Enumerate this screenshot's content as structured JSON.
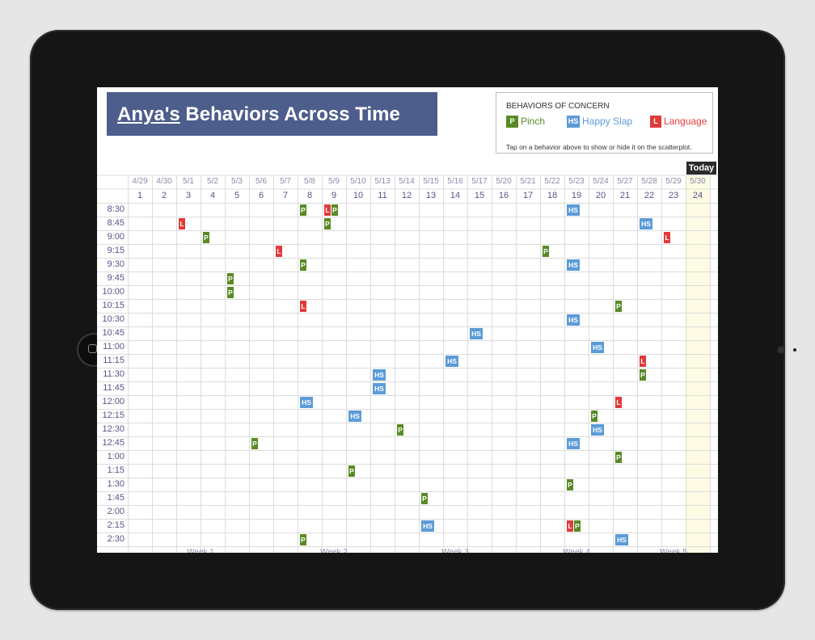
{
  "header": {
    "title_name": "Anya's",
    "title_rest": " Behaviors Across Time"
  },
  "legend": {
    "title": "BEHAVIORS OF CONCERN",
    "note": "Tap on a behavior above to show or hide it on the scatterplot.",
    "items": [
      {
        "code": "P",
        "label": "Pinch",
        "color": "#5a8a25",
        "label_color": "#5a8a25"
      },
      {
        "code": "HS",
        "label": "Happy Slap",
        "color": "#5b9bd8",
        "label_color": "#5b9bd8"
      },
      {
        "code": "L",
        "label": "Language",
        "color": "#e03b3b",
        "label_color": "#e03b3b"
      }
    ]
  },
  "today_label": "Today",
  "today_index": 23,
  "columns": [
    {
      "date": "4/29",
      "day": "1"
    },
    {
      "date": "4/30",
      "day": "2"
    },
    {
      "date": "5/1",
      "day": "3"
    },
    {
      "date": "5/2",
      "day": "4"
    },
    {
      "date": "5/3",
      "day": "5"
    },
    {
      "date": "5/6",
      "day": "6"
    },
    {
      "date": "5/7",
      "day": "7"
    },
    {
      "date": "5/8",
      "day": "8"
    },
    {
      "date": "5/9",
      "day": "9"
    },
    {
      "date": "5/10",
      "day": "10"
    },
    {
      "date": "5/13",
      "day": "11"
    },
    {
      "date": "5/14",
      "day": "12"
    },
    {
      "date": "5/15",
      "day": "13"
    },
    {
      "date": "5/16",
      "day": "14"
    },
    {
      "date": "5/17",
      "day": "15"
    },
    {
      "date": "5/20",
      "day": "16"
    },
    {
      "date": "5/21",
      "day": "17"
    },
    {
      "date": "5/22",
      "day": "18"
    },
    {
      "date": "5/23",
      "day": "19"
    },
    {
      "date": "5/24",
      "day": "20"
    },
    {
      "date": "5/27",
      "day": "21"
    },
    {
      "date": "5/28",
      "day": "22"
    },
    {
      "date": "5/29",
      "day": "23"
    },
    {
      "date": "5/30",
      "day": "24"
    }
  ],
  "times": [
    "8:30",
    "8:45",
    "9:00",
    "9:15",
    "9:30",
    "9:45",
    "10:00",
    "10:15",
    "10:30",
    "10:45",
    "11:00",
    "11:15",
    "11:30",
    "11:45",
    "12:00",
    "12:15",
    "12:30",
    "12:45",
    "1:00",
    "1:15",
    "1:30",
    "1:45",
    "2:00",
    "2:15",
    "2:30"
  ],
  "weeks": [
    {
      "label": "Week 1",
      "start": 0,
      "span": 6
    },
    {
      "label": "Week 2",
      "start": 6,
      "span": 5
    },
    {
      "label": "Week 3",
      "start": 11,
      "span": 5
    },
    {
      "label": "Week 4",
      "start": 16,
      "span": 5
    },
    {
      "label": "Week 5",
      "start": 21,
      "span": 3
    }
  ],
  "events": [
    {
      "day": 8,
      "time": "8:30",
      "codes": [
        "P"
      ]
    },
    {
      "day": 9,
      "time": "8:30",
      "codes": [
        "L",
        "P"
      ]
    },
    {
      "day": 19,
      "time": "8:30",
      "codes": [
        "HS"
      ]
    },
    {
      "day": 3,
      "time": "8:45",
      "codes": [
        "L"
      ]
    },
    {
      "day": 9,
      "time": "8:45",
      "codes": [
        "P"
      ]
    },
    {
      "day": 22,
      "time": "8:45",
      "codes": [
        "HS"
      ]
    },
    {
      "day": 4,
      "time": "9:00",
      "codes": [
        "P"
      ]
    },
    {
      "day": 23,
      "time": "9:00",
      "codes": [
        "L"
      ]
    },
    {
      "day": 7,
      "time": "9:15",
      "codes": [
        "L"
      ]
    },
    {
      "day": 18,
      "time": "9:15",
      "codes": [
        "P"
      ]
    },
    {
      "day": 8,
      "time": "9:30",
      "codes": [
        "P"
      ]
    },
    {
      "day": 19,
      "time": "9:30",
      "codes": [
        "HS"
      ]
    },
    {
      "day": 5,
      "time": "9:45",
      "codes": [
        "P"
      ]
    },
    {
      "day": 5,
      "time": "10:00",
      "codes": [
        "P"
      ]
    },
    {
      "day": 8,
      "time": "10:15",
      "codes": [
        "L"
      ]
    },
    {
      "day": 21,
      "time": "10:15",
      "codes": [
        "P"
      ]
    },
    {
      "day": 19,
      "time": "10:30",
      "codes": [
        "HS"
      ]
    },
    {
      "day": 15,
      "time": "10:45",
      "codes": [
        "HS"
      ]
    },
    {
      "day": 20,
      "time": "11:00",
      "codes": [
        "HS"
      ]
    },
    {
      "day": 14,
      "time": "11:15",
      "codes": [
        "HS"
      ]
    },
    {
      "day": 22,
      "time": "11:15",
      "codes": [
        "L"
      ]
    },
    {
      "day": 11,
      "time": "11:30",
      "codes": [
        "HS"
      ]
    },
    {
      "day": 22,
      "time": "11:30",
      "codes": [
        "P"
      ]
    },
    {
      "day": 11,
      "time": "11:45",
      "codes": [
        "HS"
      ]
    },
    {
      "day": 8,
      "time": "12:00",
      "codes": [
        "HS"
      ]
    },
    {
      "day": 21,
      "time": "12:00",
      "codes": [
        "L"
      ]
    },
    {
      "day": 10,
      "time": "12:15",
      "codes": [
        "HS"
      ]
    },
    {
      "day": 20,
      "time": "12:15",
      "codes": [
        "P"
      ]
    },
    {
      "day": 12,
      "time": "12:30",
      "codes": [
        "P"
      ]
    },
    {
      "day": 20,
      "time": "12:30",
      "codes": [
        "HS"
      ]
    },
    {
      "day": 6,
      "time": "12:45",
      "codes": [
        "P"
      ]
    },
    {
      "day": 19,
      "time": "12:45",
      "codes": [
        "HS"
      ]
    },
    {
      "day": 21,
      "time": "1:00",
      "codes": [
        "P"
      ]
    },
    {
      "day": 10,
      "time": "1:15",
      "codes": [
        "P"
      ]
    },
    {
      "day": 19,
      "time": "1:30",
      "codes": [
        "P"
      ]
    },
    {
      "day": 13,
      "time": "1:45",
      "codes": [
        "P"
      ]
    },
    {
      "day": 13,
      "time": "2:15",
      "codes": [
        "HS"
      ]
    },
    {
      "day": 19,
      "time": "2:15",
      "codes": [
        "L",
        "P"
      ]
    },
    {
      "day": 8,
      "time": "2:30",
      "codes": [
        "P"
      ]
    },
    {
      "day": 21,
      "time": "2:30",
      "codes": [
        "HS"
      ]
    }
  ],
  "colors": {
    "P": "#5a8a25",
    "HS": "#5b9bd8",
    "L": "#e03b3b",
    "title_bg": "#4d5e8c",
    "today_column": "#fdfbe3"
  }
}
